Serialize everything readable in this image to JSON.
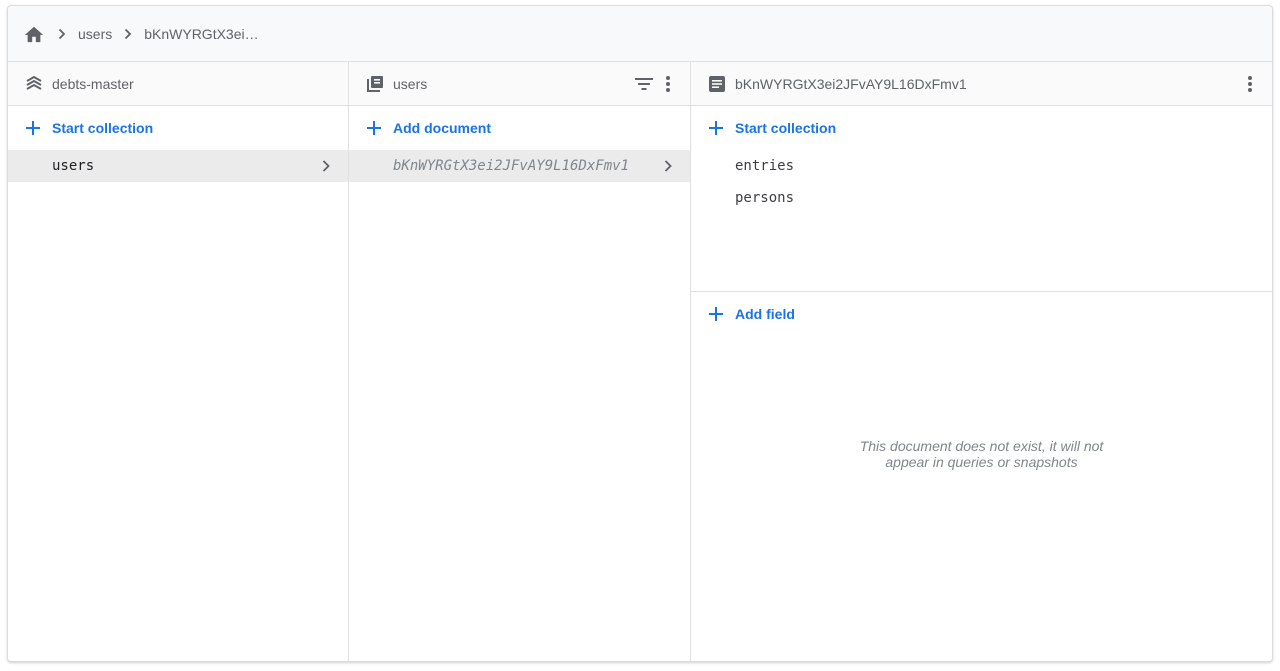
{
  "breadcrumb": {
    "items": [
      "users",
      "bKnWYRGtX3ei…"
    ]
  },
  "panels": {
    "root": {
      "title": "debts-master",
      "action_label": "Start collection",
      "items": [
        "users"
      ]
    },
    "collection": {
      "title": "users",
      "action_label": "Add document",
      "items": [
        "bKnWYRGtX3ei2JFvAY9L16DxFmv1"
      ]
    },
    "document": {
      "title": "bKnWYRGtX3ei2JFvAY9L16DxFmv1",
      "action_label": "Start collection",
      "subcollections": [
        "entries",
        "persons"
      ],
      "add_field_label": "Add field",
      "empty_message_line1": "This document does not exist, it will not",
      "empty_message_line2": "appear in queries or snapshots"
    }
  },
  "colors": {
    "accent": "#1a73e8",
    "icon": "#5f6368",
    "selected_row": "#ebebeb"
  }
}
